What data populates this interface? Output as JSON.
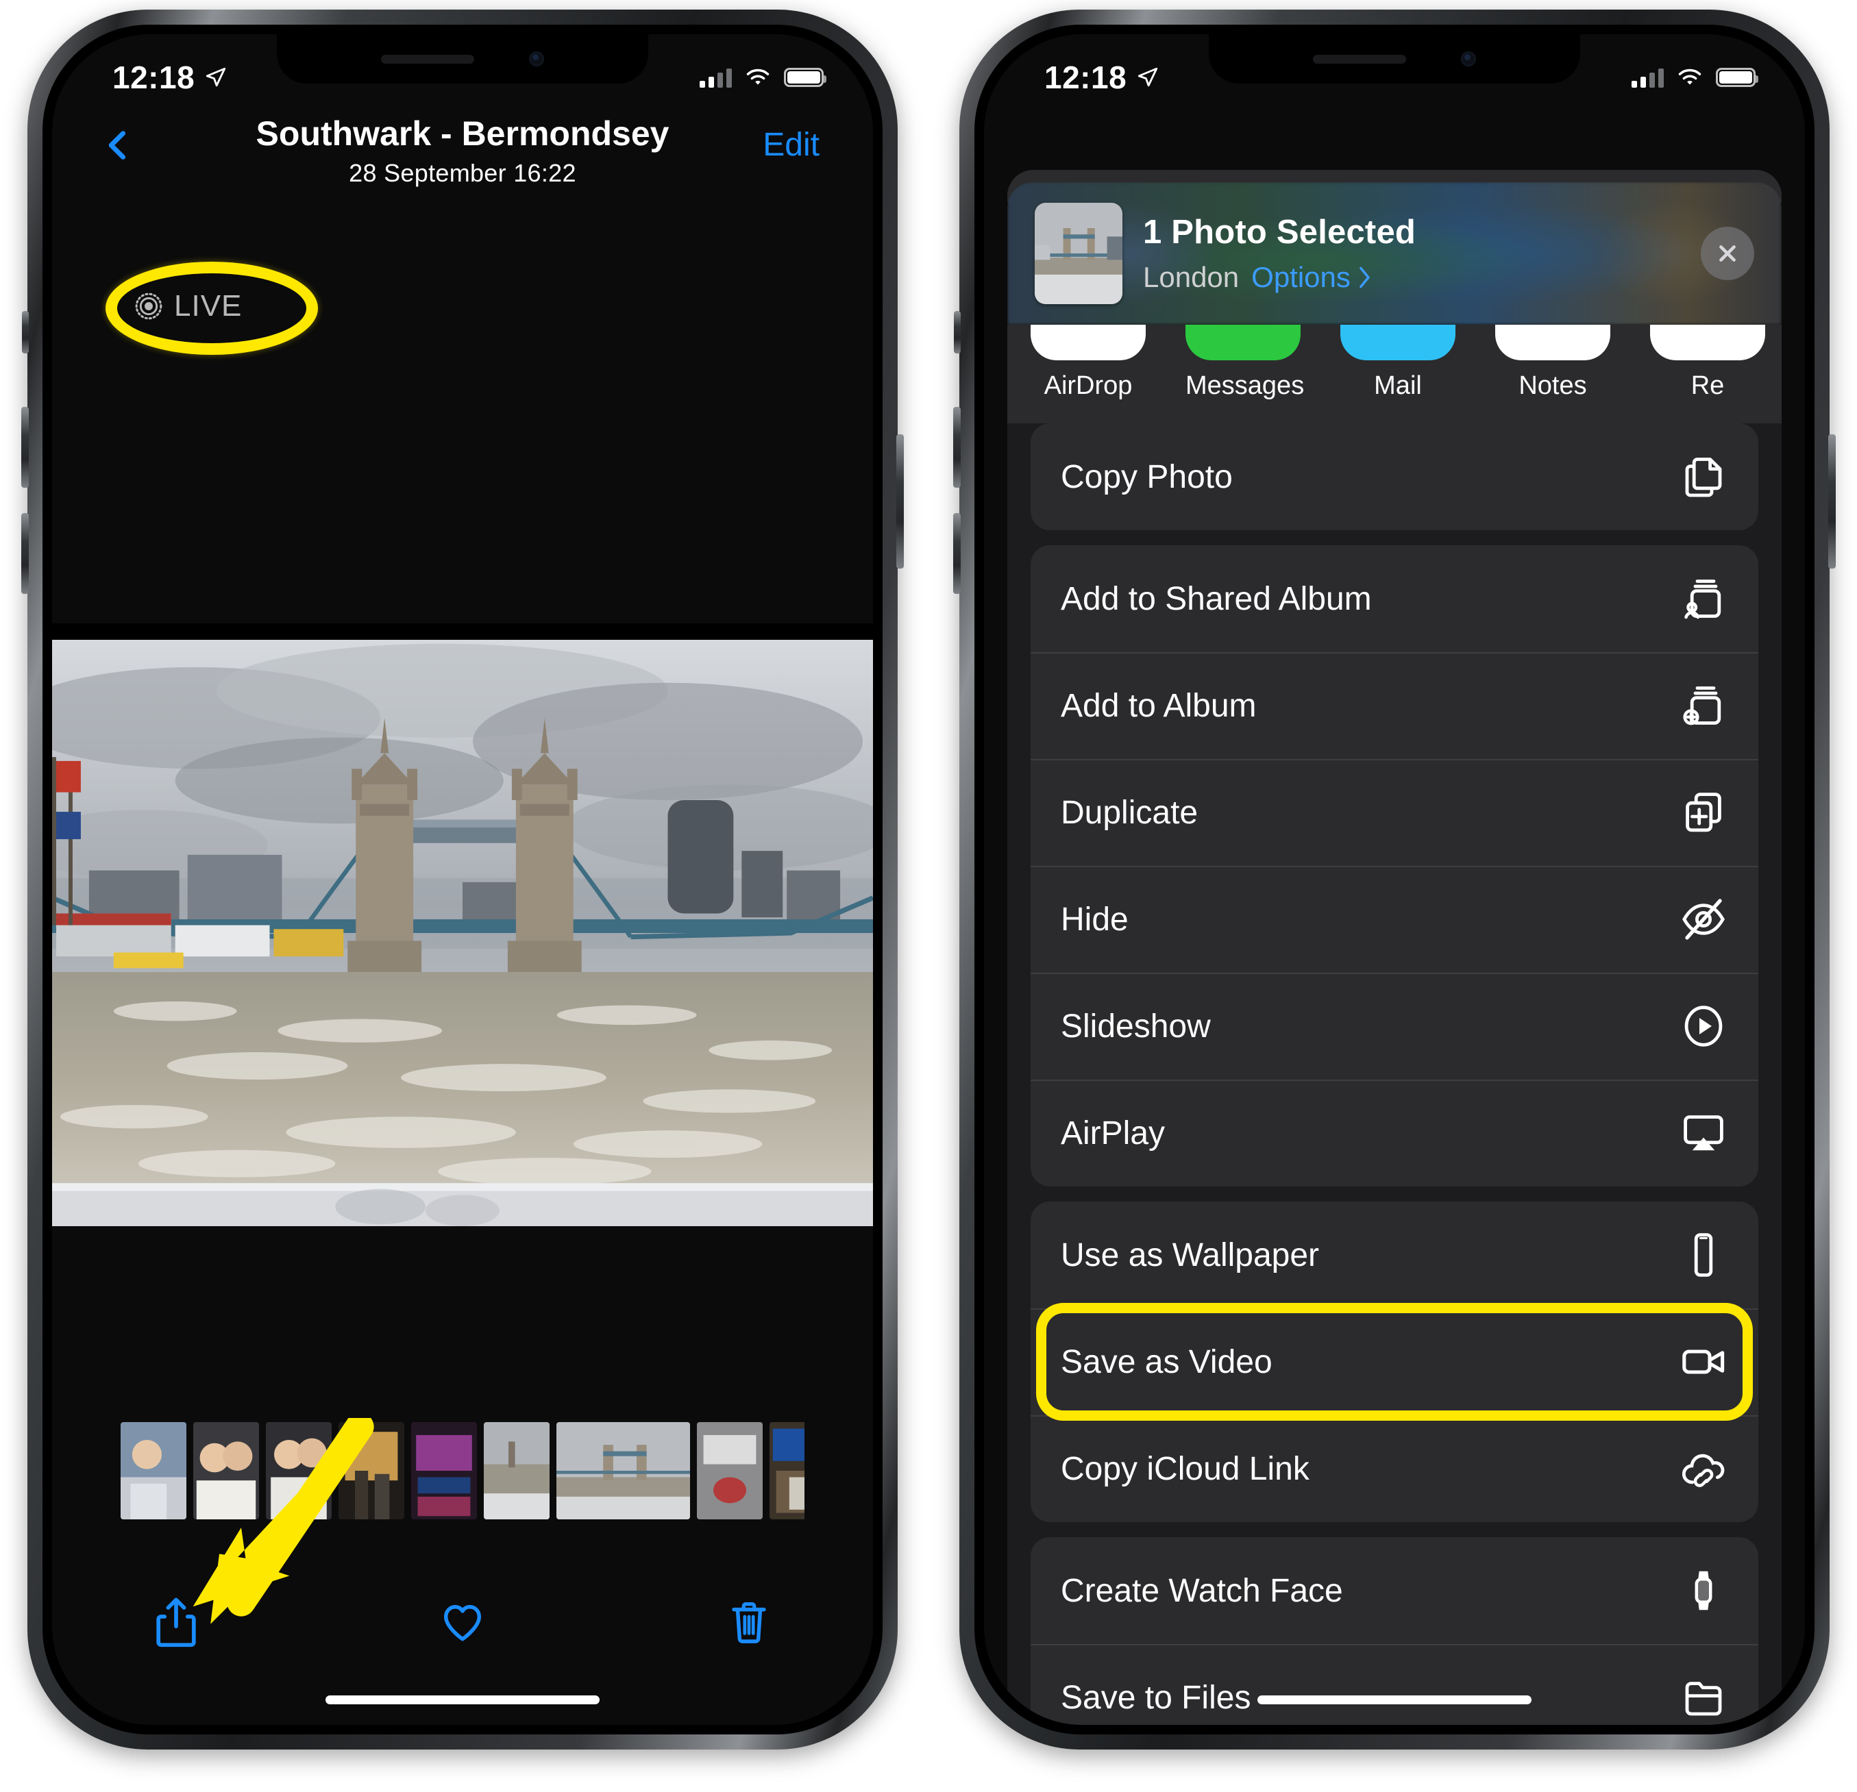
{
  "left_phone": {
    "status_bar": {
      "time": "12:18",
      "location_icon": "location-arrow-icon",
      "signal_icon": "cellular-signal-icon",
      "wifi_icon": "wifi-icon",
      "battery_icon": "battery-full-icon"
    },
    "nav": {
      "back_icon": "chevron-left-icon",
      "title": "Southwark - Bermondsey",
      "date": "28 September",
      "time": "16:22",
      "subtitle": "28 September  16:22",
      "edit_label": "Edit"
    },
    "live_badge": {
      "icon": "live-photo-icon",
      "label": "LIVE"
    },
    "photo": {
      "alt": "Tower Bridge over the River Thames on a cloudy day, seen from a boat wake"
    },
    "filmstrip": {
      "count": 9
    },
    "toolbar": {
      "share_icon": "share-icon",
      "favorite_icon": "heart-icon",
      "delete_icon": "trash-icon"
    },
    "annotations": {
      "ellipse_target": "LIVE",
      "arrow_points_to": "share-icon",
      "highlight_color": "#ffe800"
    }
  },
  "right_phone": {
    "status_bar": {
      "time": "12:18",
      "location_icon": "location-arrow-icon",
      "signal_icon": "cellular-signal-icon",
      "wifi_icon": "wifi-icon",
      "battery_icon": "battery-full-icon"
    },
    "share_sheet": {
      "thumbnail_alt": "Tower Bridge photo thumbnail",
      "title": "1 Photo Selected",
      "location": "London",
      "options_label": "Options",
      "options_chevron": "chevron-right-icon",
      "close_icon": "close-icon",
      "apps": [
        {
          "label": "AirDrop",
          "color": "#ffffff"
        },
        {
          "label": "Messages",
          "color": "#2bc840"
        },
        {
          "label": "Mail",
          "color": "#2ec1f5"
        },
        {
          "label": "Notes",
          "color": "#ffffff"
        },
        {
          "label": "Re",
          "color": "#ffffff"
        }
      ],
      "groups": [
        {
          "items": [
            {
              "label": "Copy Photo",
              "icon": "copy-icon",
              "highlighted": false
            }
          ]
        },
        {
          "items": [
            {
              "label": "Add to Shared Album",
              "icon": "shared-album-icon",
              "highlighted": false
            },
            {
              "label": "Add to Album",
              "icon": "add-album-icon",
              "highlighted": false
            },
            {
              "label": "Duplicate",
              "icon": "duplicate-icon",
              "highlighted": false
            },
            {
              "label": "Hide",
              "icon": "eye-slash-icon",
              "highlighted": false
            },
            {
              "label": "Slideshow",
              "icon": "play-circle-icon",
              "highlighted": false
            },
            {
              "label": "AirPlay",
              "icon": "airplay-icon",
              "highlighted": false
            }
          ]
        },
        {
          "items": [
            {
              "label": "Use as Wallpaper",
              "icon": "iphone-icon",
              "highlighted": false
            },
            {
              "label": "Save as Video",
              "icon": "video-camera-icon",
              "highlighted": true
            },
            {
              "label": "Copy iCloud Link",
              "icon": "icloud-link-icon",
              "highlighted": false
            }
          ]
        },
        {
          "items": [
            {
              "label": "Create Watch Face",
              "icon": "apple-watch-icon",
              "highlighted": false
            },
            {
              "label": "Save to Files",
              "icon": "folder-icon",
              "highlighted": false
            }
          ]
        }
      ],
      "annotations": {
        "highlight_target": "Save as Video",
        "highlight_color": "#ffe800"
      }
    }
  }
}
